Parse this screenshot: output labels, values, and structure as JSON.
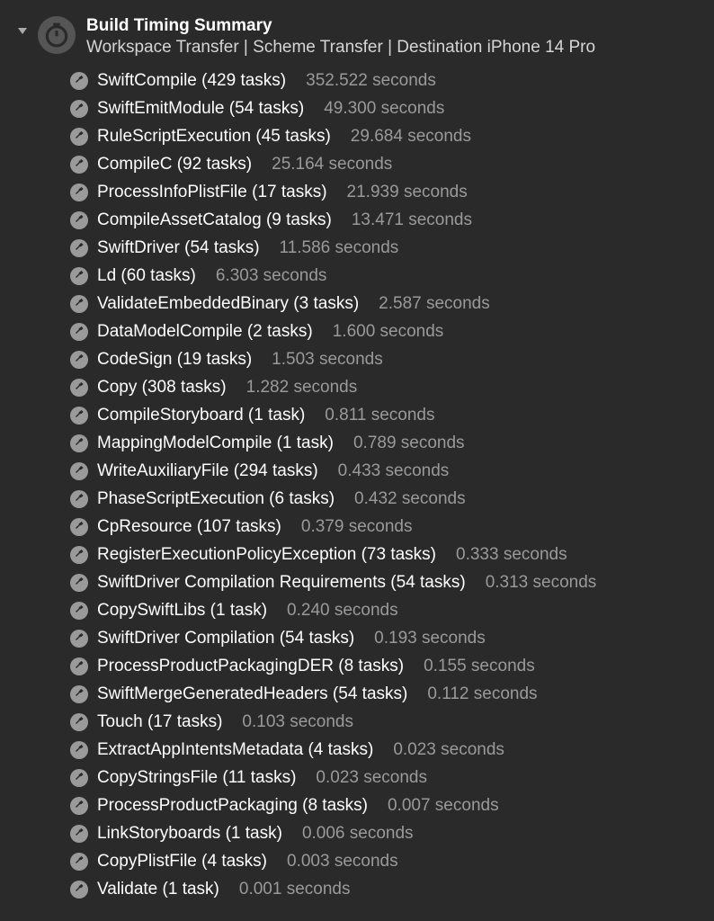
{
  "header": {
    "title": "Build Timing Summary",
    "subtitle": "Workspace Transfer | Scheme Transfer | Destination iPhone 14 Pro"
  },
  "tasks": [
    {
      "name": "SwiftCompile",
      "count_label": "(429 tasks)",
      "time": "352.522 seconds"
    },
    {
      "name": "SwiftEmitModule",
      "count_label": "(54 tasks)",
      "time": "49.300 seconds"
    },
    {
      "name": "RuleScriptExecution",
      "count_label": "(45 tasks)",
      "time": "29.684 seconds"
    },
    {
      "name": "CompileC",
      "count_label": "(92 tasks)",
      "time": "25.164 seconds"
    },
    {
      "name": "ProcessInfoPlistFile",
      "count_label": "(17 tasks)",
      "time": "21.939 seconds"
    },
    {
      "name": "CompileAssetCatalog",
      "count_label": "(9 tasks)",
      "time": "13.471 seconds"
    },
    {
      "name": "SwiftDriver",
      "count_label": "(54 tasks)",
      "time": "11.586 seconds"
    },
    {
      "name": "Ld",
      "count_label": "(60 tasks)",
      "time": "6.303 seconds"
    },
    {
      "name": "ValidateEmbeddedBinary",
      "count_label": "(3 tasks)",
      "time": "2.587 seconds"
    },
    {
      "name": "DataModelCompile",
      "count_label": "(2 tasks)",
      "time": "1.600 seconds"
    },
    {
      "name": "CodeSign",
      "count_label": "(19 tasks)",
      "time": "1.503 seconds"
    },
    {
      "name": "Copy",
      "count_label": "(308 tasks)",
      "time": "1.282 seconds"
    },
    {
      "name": "CompileStoryboard",
      "count_label": "(1 task)",
      "time": "0.811 seconds"
    },
    {
      "name": "MappingModelCompile",
      "count_label": "(1 task)",
      "time": "0.789 seconds"
    },
    {
      "name": "WriteAuxiliaryFile",
      "count_label": "(294 tasks)",
      "time": "0.433 seconds"
    },
    {
      "name": "PhaseScriptExecution",
      "count_label": "(6 tasks)",
      "time": "0.432 seconds"
    },
    {
      "name": "CpResource",
      "count_label": "(107 tasks)",
      "time": "0.379 seconds"
    },
    {
      "name": "RegisterExecutionPolicyException",
      "count_label": "(73 tasks)",
      "time": "0.333 seconds"
    },
    {
      "name": "SwiftDriver Compilation Requirements",
      "count_label": "(54 tasks)",
      "time": "0.313 seconds"
    },
    {
      "name": "CopySwiftLibs",
      "count_label": "(1 task)",
      "time": "0.240 seconds"
    },
    {
      "name": "SwiftDriver Compilation",
      "count_label": "(54 tasks)",
      "time": "0.193 seconds"
    },
    {
      "name": "ProcessProductPackagingDER",
      "count_label": "(8 tasks)",
      "time": "0.155 seconds"
    },
    {
      "name": "SwiftMergeGeneratedHeaders",
      "count_label": "(54 tasks)",
      "time": "0.112 seconds"
    },
    {
      "name": "Touch",
      "count_label": "(17 tasks)",
      "time": "0.103 seconds"
    },
    {
      "name": "ExtractAppIntentsMetadata",
      "count_label": "(4 tasks)",
      "time": "0.023 seconds"
    },
    {
      "name": "CopyStringsFile",
      "count_label": "(11 tasks)",
      "time": "0.023 seconds"
    },
    {
      "name": "ProcessProductPackaging",
      "count_label": "(8 tasks)",
      "time": "0.007 seconds"
    },
    {
      "name": "LinkStoryboards",
      "count_label": "(1 task)",
      "time": "0.006 seconds"
    },
    {
      "name": "CopyPlistFile",
      "count_label": "(4 tasks)",
      "time": "0.003 seconds"
    },
    {
      "name": "Validate",
      "count_label": "(1 task)",
      "time": "0.001 seconds"
    }
  ]
}
